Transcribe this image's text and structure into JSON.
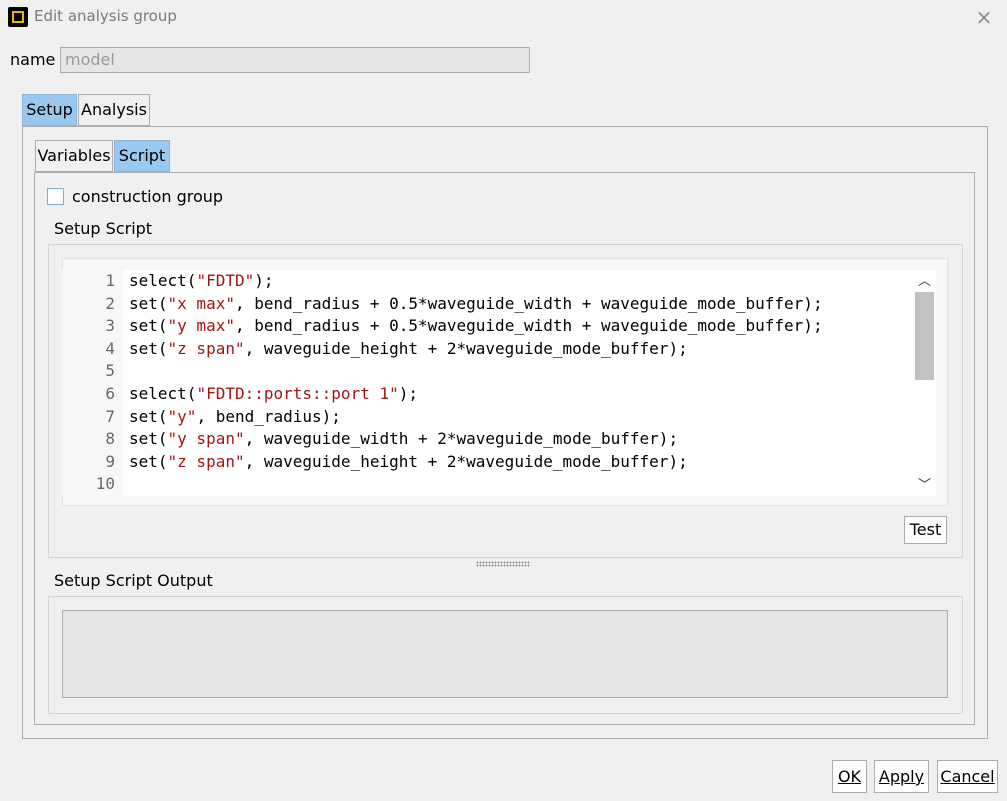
{
  "window": {
    "title": "Edit analysis group",
    "close_icon": "×"
  },
  "name_field": {
    "label": "name",
    "value": "model"
  },
  "main_tabs": [
    {
      "label": "Setup",
      "active": true
    },
    {
      "label": "Analysis",
      "active": false
    }
  ],
  "sub_tabs": [
    {
      "label": "Variables",
      "active": false
    },
    {
      "label": "Script",
      "active": true
    }
  ],
  "construction_group": {
    "label": "construction group",
    "checked": false
  },
  "setup_script": {
    "label": "Setup Script",
    "line_numbers": [
      "1",
      "2",
      "3",
      "4",
      "5",
      "6",
      "7",
      "8",
      "9",
      "10"
    ],
    "lines": [
      [
        {
          "t": "select("
        },
        {
          "t": "\"FDTD\"",
          "s": 1
        },
        {
          "t": ");"
        }
      ],
      [
        {
          "t": "set("
        },
        {
          "t": "\"x max\"",
          "s": 1
        },
        {
          "t": ", bend_radius + 0.5*waveguide_width + waveguide_mode_buffer);"
        }
      ],
      [
        {
          "t": "set("
        },
        {
          "t": "\"y max\"",
          "s": 1
        },
        {
          "t": ", bend_radius + 0.5*waveguide_width + waveguide_mode_buffer);"
        }
      ],
      [
        {
          "t": "set("
        },
        {
          "t": "\"z span\"",
          "s": 1
        },
        {
          "t": ", waveguide_height + 2*waveguide_mode_buffer);"
        }
      ],
      [
        {
          "t": ""
        }
      ],
      [
        {
          "t": "select("
        },
        {
          "t": "\"FDTD::ports::port 1\"",
          "s": 1
        },
        {
          "t": ");"
        }
      ],
      [
        {
          "t": "set("
        },
        {
          "t": "\"y\"",
          "s": 1
        },
        {
          "t": ", bend_radius);"
        }
      ],
      [
        {
          "t": "set("
        },
        {
          "t": "\"y span\"",
          "s": 1
        },
        {
          "t": ", waveguide_width + 2*waveguide_mode_buffer);"
        }
      ],
      [
        {
          "t": "set("
        },
        {
          "t": "\"z span\"",
          "s": 1
        },
        {
          "t": ", waveguide_height + 2*waveguide_mode_buffer);"
        }
      ],
      [
        {
          "t": ""
        }
      ]
    ],
    "string_color": "#a31515",
    "scroll_up_icon": "︿",
    "scroll_down_icon": "﹀",
    "test_button": "Test"
  },
  "setup_script_output": {
    "label": "Setup Script Output",
    "value": ""
  },
  "footer": {
    "ok_label": "OK",
    "apply_label": "Apply",
    "cancel_label": "Cancel"
  }
}
